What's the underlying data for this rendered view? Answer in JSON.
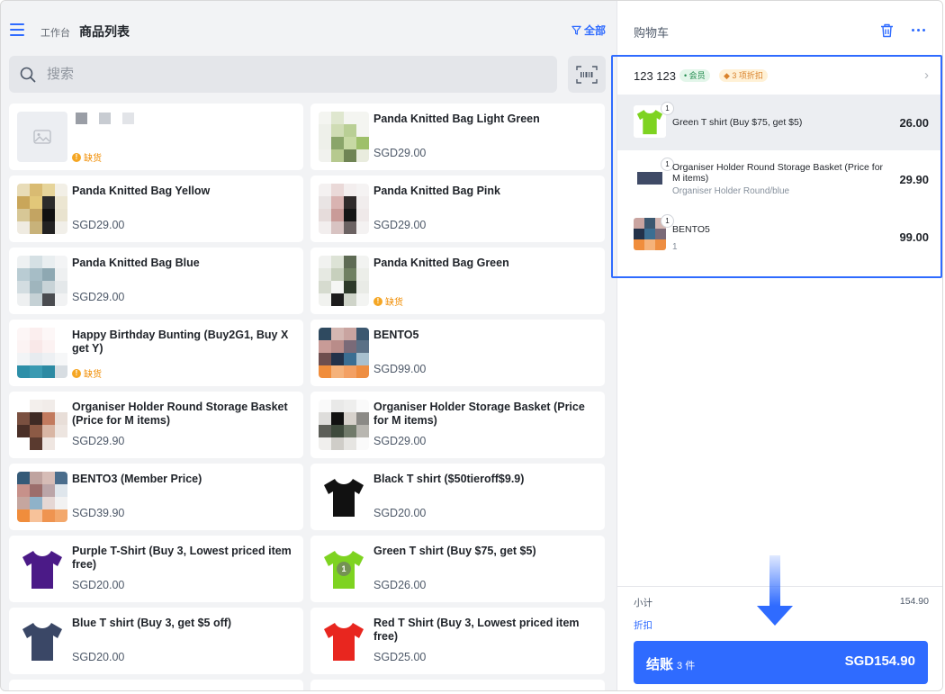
{
  "header": {
    "menu_icon": "hamburger-icon",
    "breadcrumb": "工作台",
    "title": "商品列表",
    "filter_label": "全部",
    "filter_icon": "filter-icon"
  },
  "search": {
    "placeholder": "搜索",
    "icon": "search-icon",
    "scan_icon": "barcode-scan-icon"
  },
  "products": [
    {
      "name": "",
      "price": "",
      "out_of_stock": "缺货",
      "image": "placeholder"
    },
    {
      "name": "Panda Knitted Bag Light Green",
      "price": "SGD29.00",
      "out_of_stock": ""
    },
    {
      "name": "Panda Knitted Bag Yellow",
      "price": "SGD29.00",
      "out_of_stock": ""
    },
    {
      "name": "Panda Knitted Bag Pink",
      "price": "SGD29.00",
      "out_of_stock": ""
    },
    {
      "name": "Panda Knitted Bag Blue",
      "price": "SGD29.00",
      "out_of_stock": ""
    },
    {
      "name": "Panda Knitted Bag Green",
      "price": "",
      "out_of_stock": "缺货"
    },
    {
      "name": "Happy Birthday Bunting (Buy2G1, Buy X get Y)",
      "price": "",
      "out_of_stock": "缺货"
    },
    {
      "name": "BENTO5",
      "price": "SGD99.00",
      "out_of_stock": ""
    },
    {
      "name": "Organiser Holder Round Storage Basket (Price for M items)",
      "price": "SGD29.90",
      "out_of_stock": ""
    },
    {
      "name": "Organiser Holder Storage Basket (Price for M items)",
      "price": "SGD29.00",
      "out_of_stock": ""
    },
    {
      "name": "BENTO3 (Member Price)",
      "price": "SGD39.90",
      "out_of_stock": ""
    },
    {
      "name": "Black T shirt ($50tieroff$9.9)",
      "price": "SGD20.00",
      "out_of_stock": ""
    },
    {
      "name": "Purple T-Shirt (Buy 3, Lowest priced item free)",
      "price": "SGD20.00",
      "out_of_stock": ""
    },
    {
      "name": "Green T shirt (Buy $75, get $5)",
      "price": "SGD26.00",
      "out_of_stock": "",
      "in_cart_qty": "1"
    },
    {
      "name": "Blue T shirt (Buy 3, get $5 off)",
      "price": "SGD20.00",
      "out_of_stock": ""
    },
    {
      "name": "Red T Shirt (Buy 3, Lowest priced item free)",
      "price": "SGD25.00",
      "out_of_stock": ""
    }
  ],
  "cart": {
    "title": "购物车",
    "trash_icon": "trash-icon",
    "more_icon": "more-horizontal-icon",
    "customer_name": "123 123",
    "member_tag": "会员",
    "discount_tag": "3 项折扣",
    "items": [
      {
        "qty": "1",
        "name": "Green T shirt (Buy $75, get $5)",
        "sub": "",
        "price": "26.00"
      },
      {
        "qty": "1",
        "name": "Organiser Holder Round Storage Basket (Price for M items)",
        "sub": "Organiser Holder Round/blue",
        "price": "29.90"
      },
      {
        "qty": "1",
        "name": "BENTO5",
        "sub": "1",
        "price": "99.00"
      }
    ],
    "subtotal_label": "小计",
    "subtotal_value": "154.90",
    "discount_label": "折扣",
    "checkout_label": "结账",
    "checkout_count": "3 件",
    "checkout_total": "SGD154.90"
  },
  "colors": {
    "accent": "#2f6bff",
    "warning": "#f5a623",
    "background": "#f2f3f5"
  }
}
